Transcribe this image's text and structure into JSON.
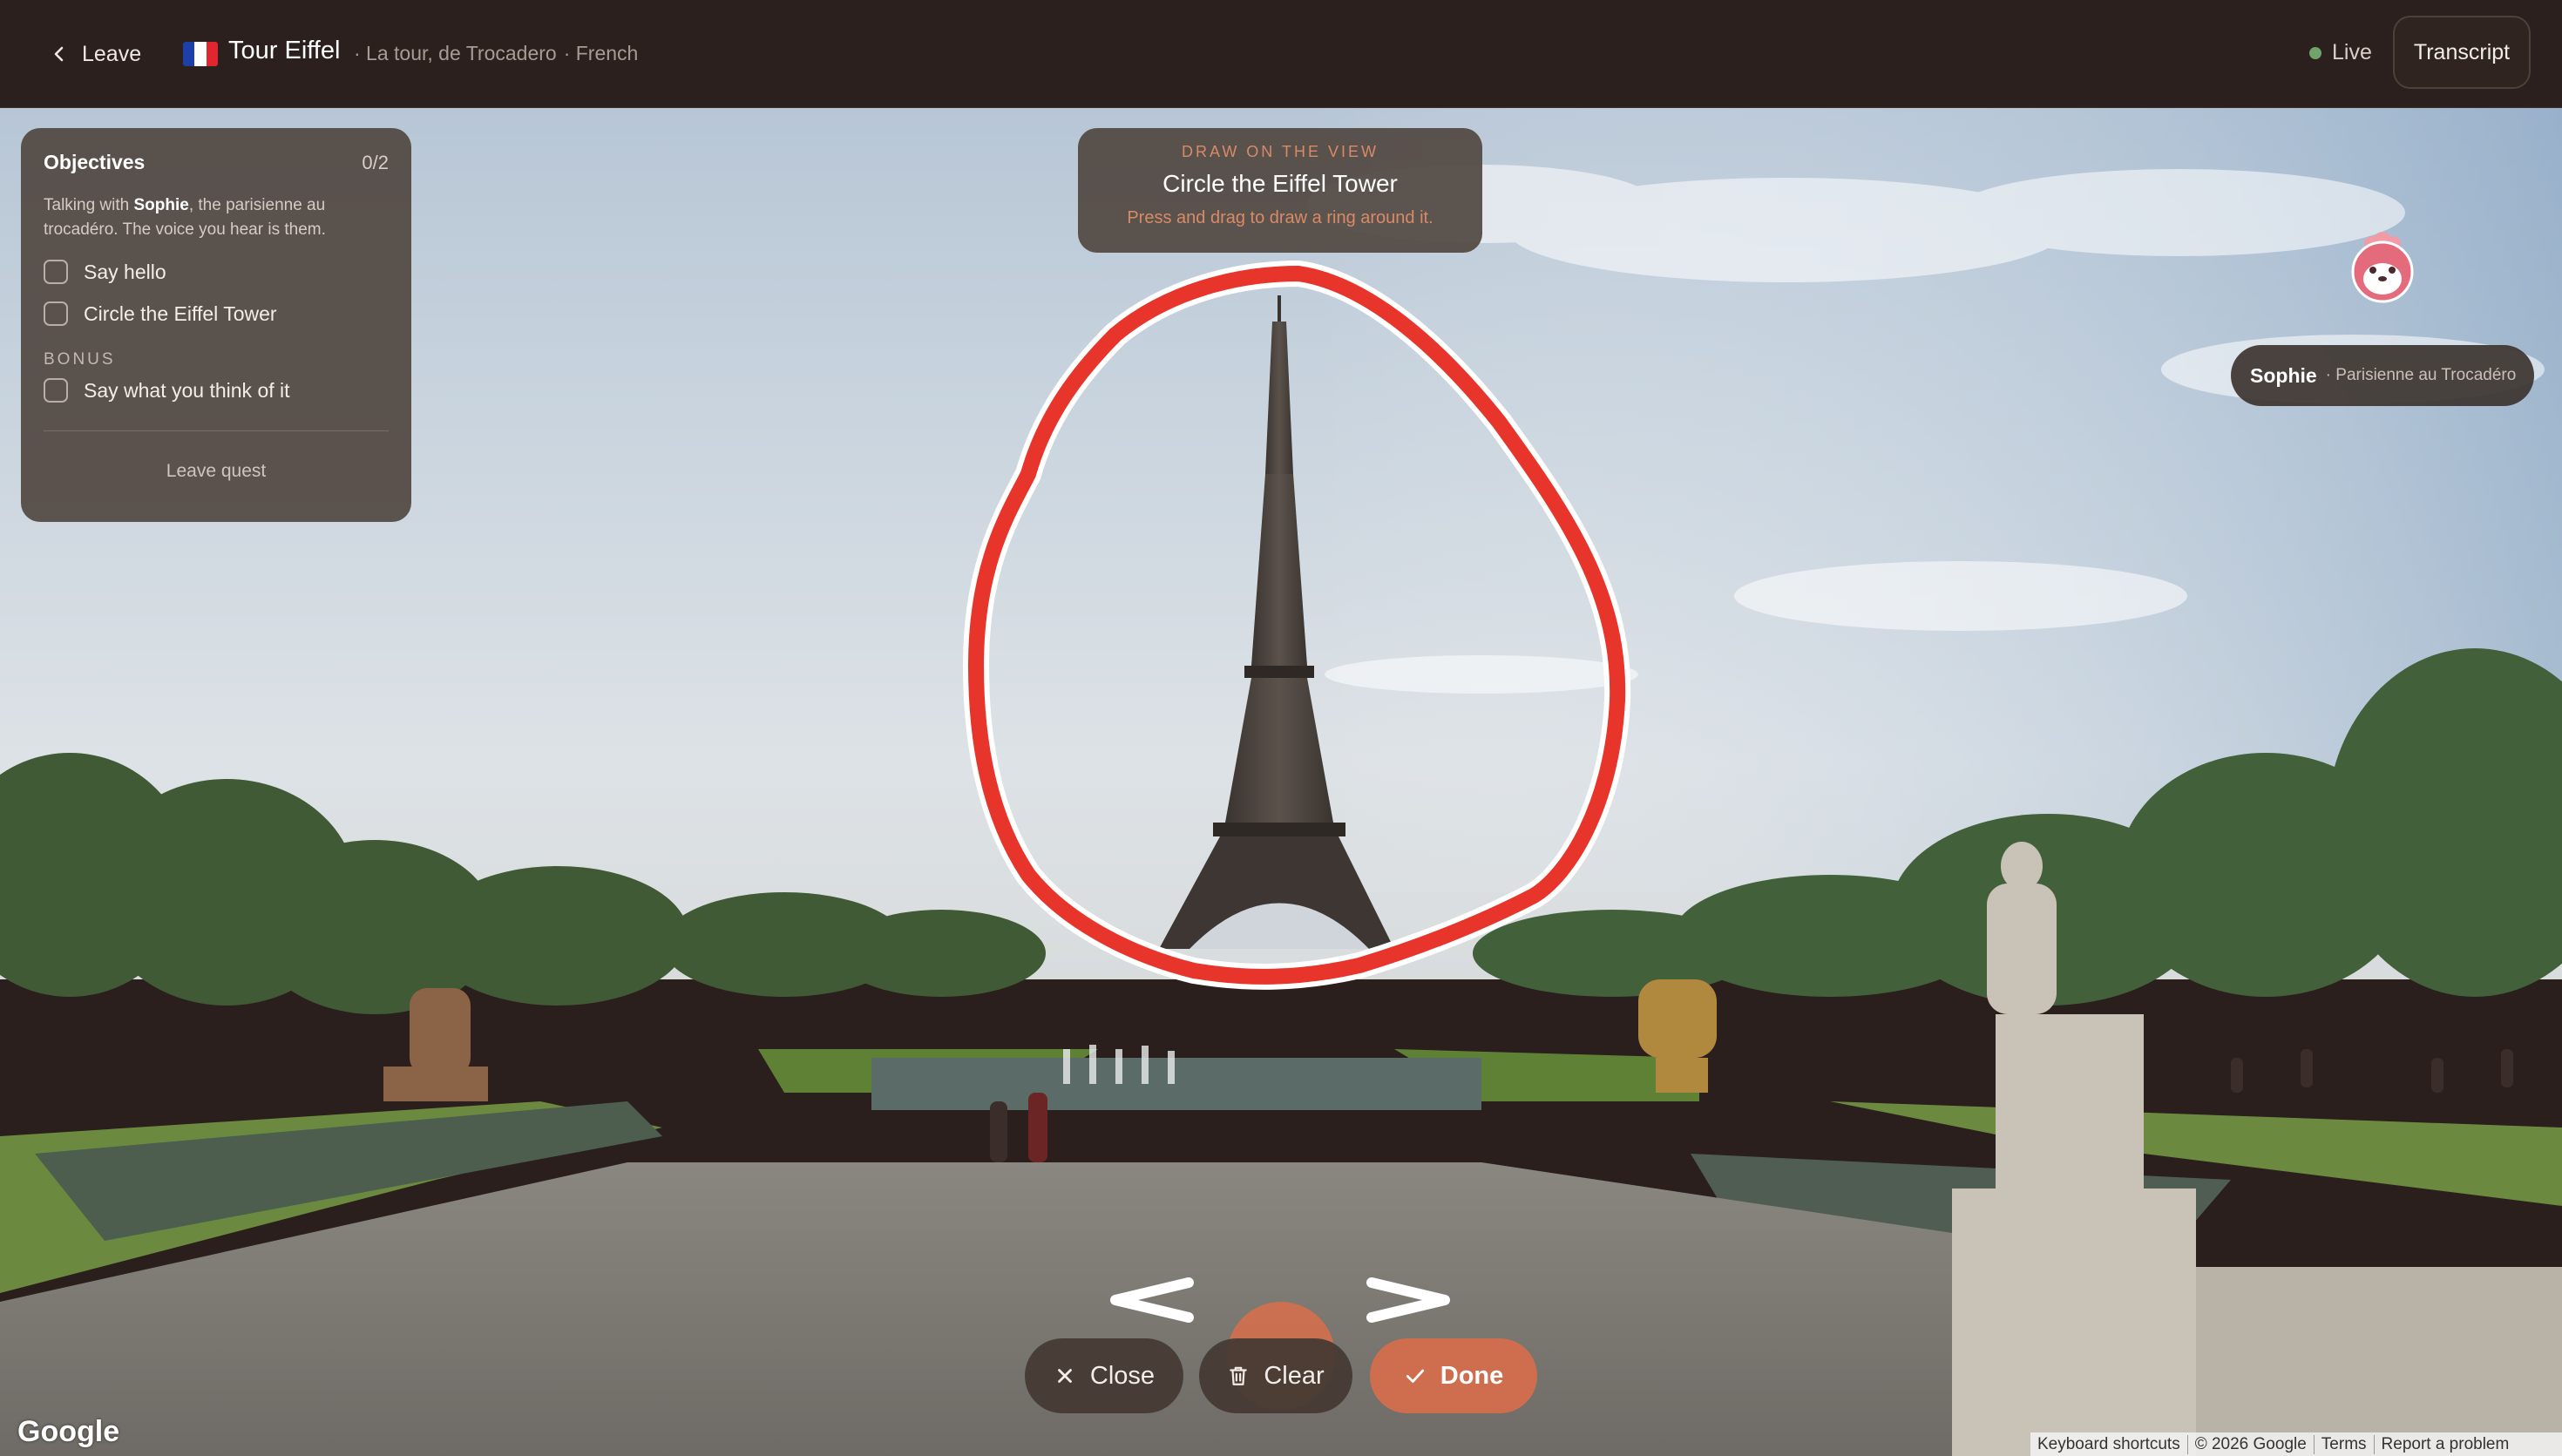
{
  "header": {
    "leave_label": "Leave",
    "title": "Tour Eiffel",
    "subtitle_place": "· La tour, de Trocadero",
    "subtitle_lang": "· French",
    "live_label": "Live",
    "transcript_label": "Transcript"
  },
  "objectives": {
    "title": "Objectives",
    "progress": "0/2",
    "intro_prefix": "Talking with ",
    "intro_name": "Sophie",
    "intro_suffix": ", the parisienne au trocadéro. The voice you hear is them.",
    "items": [
      {
        "label": "Say hello",
        "done": false
      },
      {
        "label": "Circle the Eiffel Tower",
        "done": false
      }
    ],
    "bonus_label": "BONUS",
    "bonus_items": [
      {
        "label": "Say what you think of it",
        "done": false
      }
    ],
    "leave_quest_label": "Leave quest"
  },
  "instruction": {
    "kicker": "DRAW ON THE VIEW",
    "title": "Circle the Eiffel Tower",
    "hint": "Press and drag to draw a ring around it."
  },
  "character": {
    "name": "Sophie",
    "role": "· Parisienne au Trocadéro"
  },
  "controls": {
    "close_label": "Close",
    "clear_label": "Clear",
    "done_label": "Done"
  },
  "map": {
    "logo": "Google",
    "footer": [
      "Keyboard shortcuts",
      "© 2026 Google",
      "Terms",
      "Report a problem"
    ]
  },
  "colors": {
    "accent": "#cf6e4e",
    "stroke": "#e8352b",
    "live": "#6fa36a",
    "topbar": "#2b201d"
  }
}
